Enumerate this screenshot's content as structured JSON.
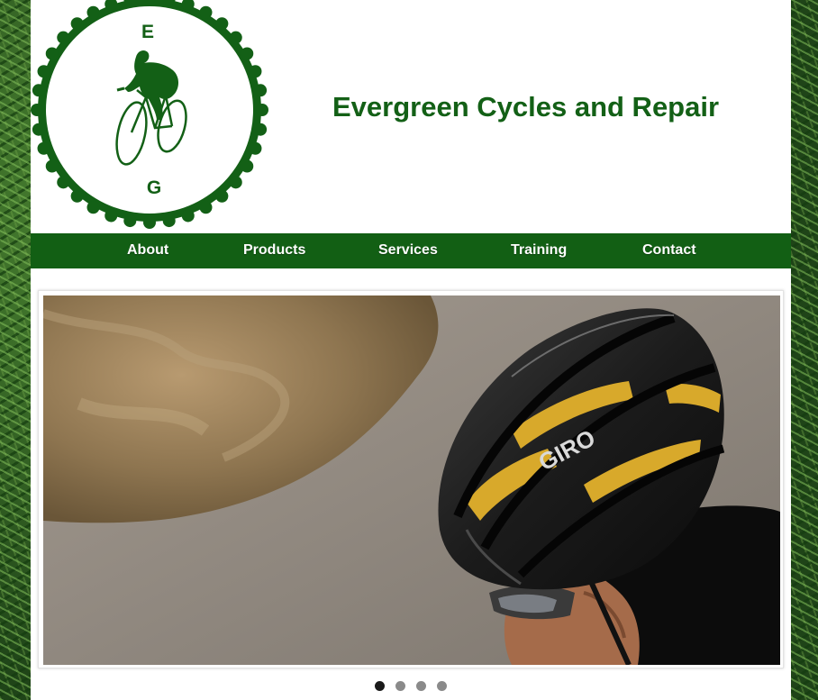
{
  "logo": {
    "top_letter": "E",
    "bottom_letter": "G",
    "icon": "cyclist-icon",
    "color": "#136016"
  },
  "header": {
    "title": "Evergreen Cycles and Repair"
  },
  "nav": {
    "background": "#125f14",
    "items": [
      {
        "label": "About"
      },
      {
        "label": "Products"
      },
      {
        "label": "Services"
      },
      {
        "label": "Training"
      },
      {
        "label": "Contact"
      }
    ]
  },
  "slider": {
    "current_slide": 1,
    "slide_count": 4,
    "helmet_brand_text": "GIRO"
  },
  "background": {
    "texture": "pine-branches"
  }
}
